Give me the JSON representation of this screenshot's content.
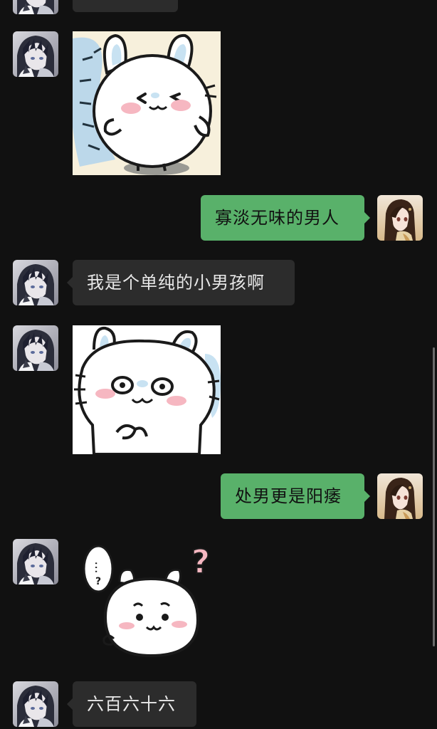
{
  "theme": {
    "background": "#111111",
    "incoming_bubble": "#2c2c2c",
    "outgoing_bubble": "#59b16a",
    "incoming_text": "#e8e8e8",
    "outgoing_text": "#111111"
  },
  "messages": [
    {
      "sender": "other",
      "type": "text",
      "text": ""
    },
    {
      "sender": "other",
      "type": "sticker",
      "sticker": "round-white-hamster-blushing"
    },
    {
      "sender": "me",
      "type": "text",
      "text": "寡淡无味的男人"
    },
    {
      "sender": "other",
      "type": "text",
      "text": "我是个单纯的小男孩啊"
    },
    {
      "sender": "other",
      "type": "sticker",
      "sticker": "white-hamster-closeup-nervous"
    },
    {
      "sender": "me",
      "type": "text",
      "text": "处男更是阳痿"
    },
    {
      "sender": "other",
      "type": "sticker",
      "sticker": "white-hamster-confused"
    },
    {
      "sender": "other",
      "type": "text",
      "text": "六百六十六"
    }
  ],
  "sticker_caption": {
    "dots": "...",
    "mark": "?",
    "big_mark": "?"
  }
}
